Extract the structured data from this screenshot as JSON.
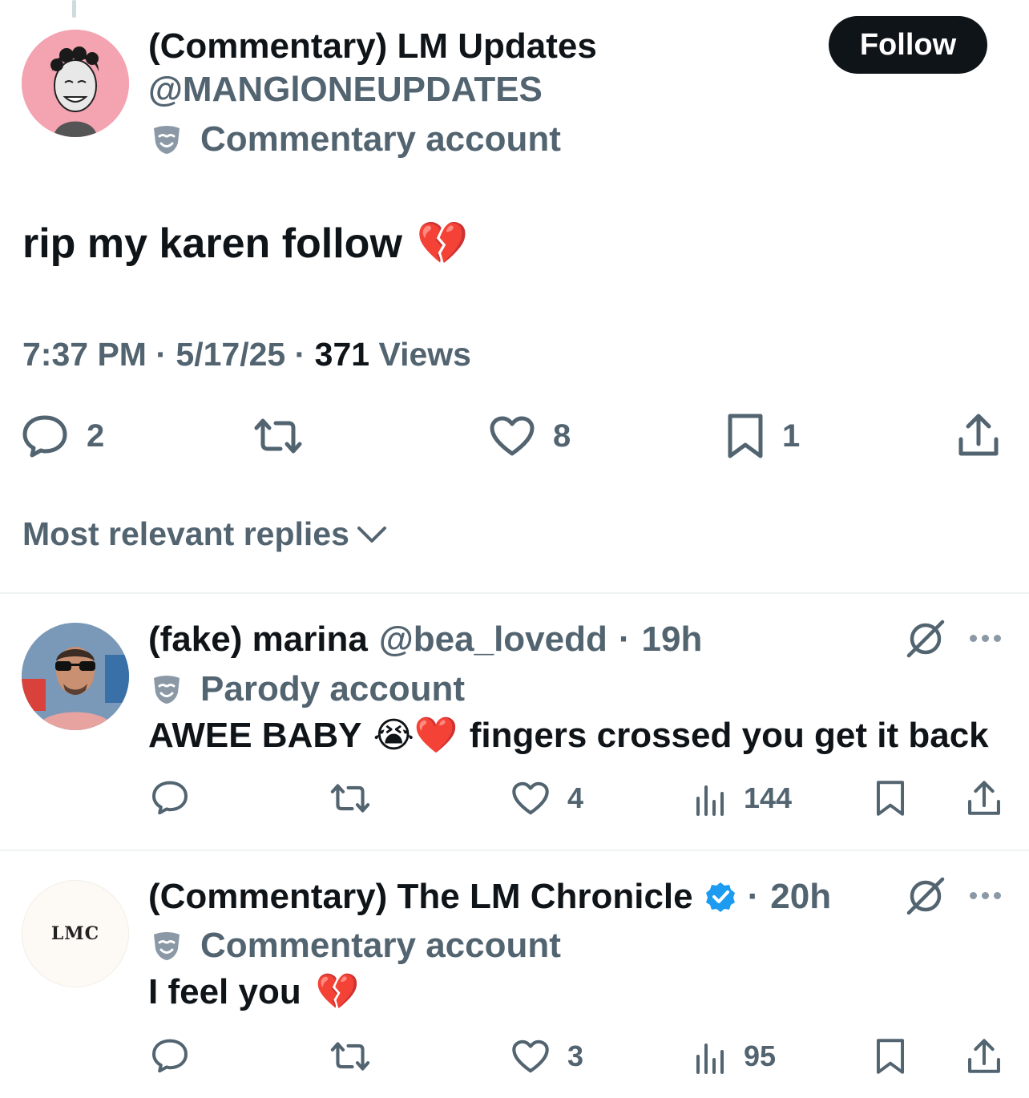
{
  "post": {
    "display_name": "(Commentary) LM Updates",
    "handle": "@MANGlONEUPDATES",
    "account_label": "Commentary account",
    "follow_label": "Follow",
    "text": "rip my karen follow",
    "emoji": "💔",
    "time": "7:37 PM",
    "date": "5/17/25",
    "views_count": "371",
    "views_label": "Views",
    "stats": {
      "replies": "2",
      "reposts": "",
      "likes": "8",
      "bookmarks": "1"
    }
  },
  "sort": {
    "label": "Most relevant replies"
  },
  "replies": [
    {
      "name": "(fake) marina",
      "handle": "@bea_lovedd",
      "time": "19h",
      "label": "Parody account",
      "text_before": "AWEE BABY",
      "emoji": "😭❤️",
      "text_after": "fingers crossed you get it back",
      "likes": "4",
      "views": "144"
    },
    {
      "name": "(Commentary) The LM Chronicle",
      "verified": true,
      "time": "20h",
      "label": "Commentary account",
      "text_before": "I feel you",
      "emoji": "💔",
      "likes": "3",
      "views": "95",
      "avatar_text": "LMC"
    }
  ],
  "colors": {
    "text_primary": "#0f1419",
    "text_secondary": "#536471",
    "button_bg": "#0f1419",
    "verified": "#1d9bf0",
    "divider": "#eff3f4"
  }
}
